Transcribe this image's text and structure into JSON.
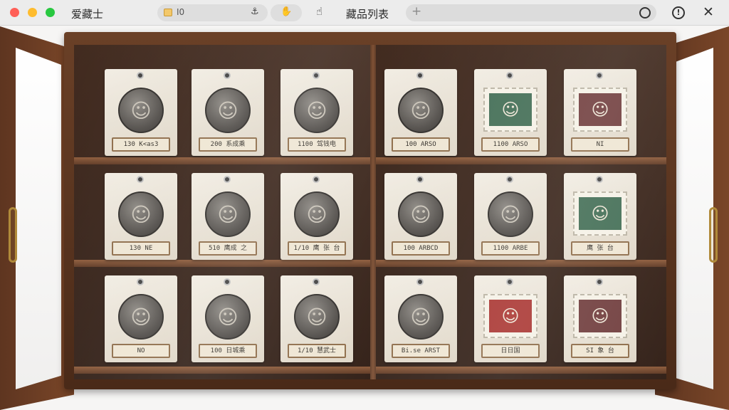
{
  "window": {
    "app_title": "爱藏士",
    "tab_text": "I0",
    "page_title": "藏品列表"
  },
  "icons": {
    "tab_folder": "folder-icon",
    "tab_action": "anchor-icon",
    "nav_a": "hand-icon",
    "nav_b": "pointer-hand-icon",
    "new_tab": "plus-icon",
    "record": "circle-icon",
    "info": "info-icon",
    "close": "close-icon"
  },
  "colors": {
    "wood": "#5e3520",
    "brass": "#b08a3a",
    "stamp_green": "#3f6b52",
    "stamp_maroon": "#6e3a3a",
    "stamp_red": "#a8322e"
  },
  "items": [
    {
      "type": "coin",
      "label": "130  K<as3"
    },
    {
      "type": "coin",
      "label": "200  系成乘"
    },
    {
      "type": "coin",
      "label": "1100  驾钱电"
    },
    {
      "type": "coin",
      "label": "100  ARSO"
    },
    {
      "type": "stamp",
      "label": "1100  ARSO"
    },
    {
      "type": "stamp",
      "label": "NI"
    },
    {
      "type": "coin",
      "label": "130  NE"
    },
    {
      "type": "coin",
      "label": "510  鹰成 之"
    },
    {
      "type": "coin",
      "label": "1/10  鹰 张 台"
    },
    {
      "type": "coin",
      "label": "100  ARBCD"
    },
    {
      "type": "coin",
      "label": "1100  ARBE"
    },
    {
      "type": "stamp",
      "label": "鹰 张 台"
    },
    {
      "type": "coin",
      "label": "NO"
    },
    {
      "type": "coin",
      "label": "100  日城乘"
    },
    {
      "type": "coin",
      "label": "1/10  慧武士"
    },
    {
      "type": "coin",
      "label": "Bi.se  ARST"
    },
    {
      "type": "stamp",
      "label": "日日国"
    },
    {
      "type": "stamp",
      "label": "SI  象 台"
    }
  ]
}
